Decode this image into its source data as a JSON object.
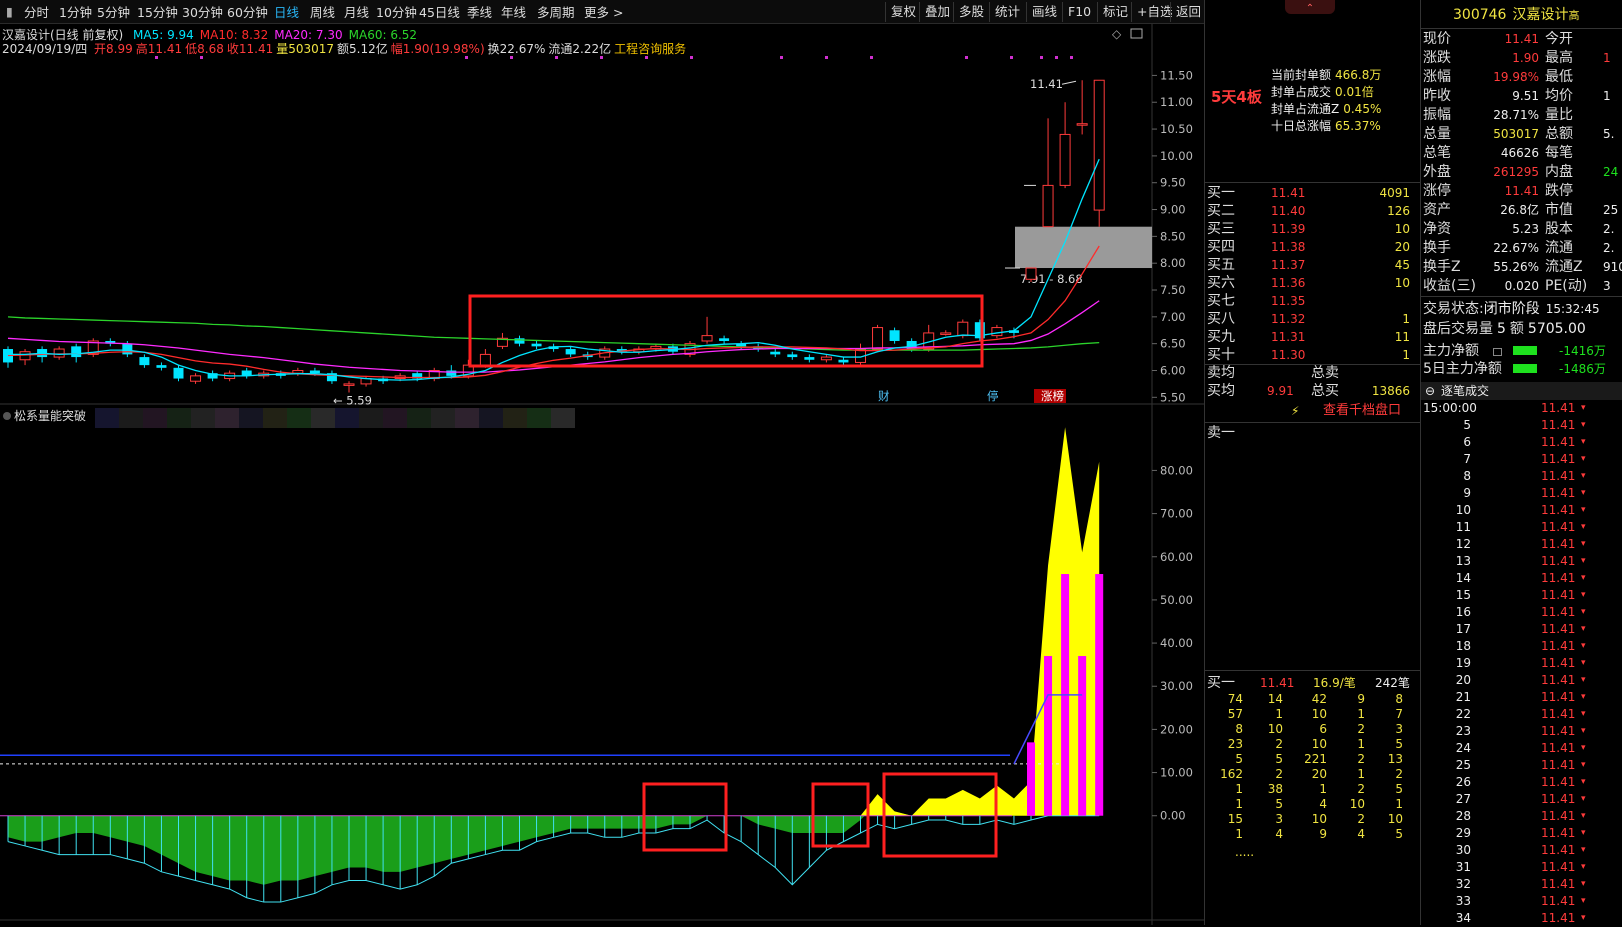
{
  "toolbar": {
    "periods": [
      "分时",
      "1分钟",
      "5分钟",
      "15分钟",
      "30分钟",
      "60分钟",
      "日线",
      "周线",
      "月线",
      "10分钟",
      "45日线",
      "季线",
      "年线",
      "多周期",
      "更多 >"
    ],
    "active": "日线",
    "right": [
      "复权",
      "叠加",
      "多股",
      "统计",
      "画线",
      "F10",
      "标记",
      "+自选",
      "返回"
    ]
  },
  "chart": {
    "title": "汉嘉设计(日线 前复权)",
    "ma": [
      {
        "label": "MA5: 9.94",
        "color": "#00e5ff"
      },
      {
        "label": "MA10: 8.32",
        "color": "#ff2b2b"
      },
      {
        "label": "MA20: 7.30",
        "color": "#ff2bff"
      },
      {
        "label": "MA60: 6.52",
        "color": "#2bd42b"
      }
    ],
    "date": "2024/09/19/四",
    "ohlc": [
      {
        "t": "开8.99",
        "c": "#ff3b3b"
      },
      {
        "t": "高11.41",
        "c": "#ff3b3b"
      },
      {
        "t": "低8.68",
        "c": "#ff3b3b"
      },
      {
        "t": "收11.41",
        "c": "#ff3b3b"
      },
      {
        "t": "量503017",
        "c": "#f0e442"
      },
      {
        "t": "额5.12亿",
        "c": "#ddd"
      },
      {
        "t": "幅1.90(19.98%)",
        "c": "#ff3b3b"
      },
      {
        "t": "换22.67%",
        "c": "#ddd"
      },
      {
        "t": "流通2.22亿",
        "c": "#ddd"
      },
      {
        "t": "工程咨询服务",
        "c": "#f0c000"
      }
    ],
    "y_ticks": [
      "11.50",
      "11.00",
      "10.50",
      "10.00",
      "9.50",
      "9.00",
      "8.50",
      "8.00",
      "7.50",
      "7.00",
      "6.50",
      "6.00",
      "5.50"
    ],
    "y_range": [
      5.45,
      11.75
    ],
    "high_label": "11.41",
    "low_label": "5.59",
    "gap_label": "7.91 - 8.68",
    "markers": [
      "财",
      "停",
      "涨榜"
    ],
    "candles": [
      [
        6.4,
        6.15,
        6.45,
        6.05
      ],
      [
        6.2,
        6.35,
        6.4,
        6.1
      ],
      [
        6.4,
        6.25,
        6.45,
        6.15
      ],
      [
        6.25,
        6.4,
        6.45,
        6.2
      ],
      [
        6.45,
        6.25,
        6.5,
        6.15
      ],
      [
        6.3,
        6.55,
        6.6,
        6.25
      ],
      [
        6.55,
        6.5,
        6.6,
        6.45
      ],
      [
        6.5,
        6.3,
        6.55,
        6.25
      ],
      [
        6.25,
        6.1,
        6.3,
        6.05
      ],
      [
        6.1,
        6.05,
        6.15,
        6.0
      ],
      [
        6.05,
        5.85,
        6.1,
        5.8
      ],
      [
        5.8,
        5.9,
        5.95,
        5.75
      ],
      [
        5.95,
        5.85,
        6.0,
        5.8
      ],
      [
        5.85,
        5.95,
        6.0,
        5.8
      ],
      [
        6.0,
        5.9,
        6.05,
        5.85
      ],
      [
        5.9,
        5.95,
        6.0,
        5.85
      ],
      [
        5.95,
        5.9,
        6.0,
        5.85
      ],
      [
        5.95,
        6.0,
        6.05,
        5.9
      ],
      [
        6.0,
        5.95,
        6.05,
        5.9
      ],
      [
        5.95,
        5.8,
        6.0,
        5.75
      ],
      [
        5.75,
        5.75,
        5.8,
        5.59
      ],
      [
        5.75,
        5.85,
        5.9,
        5.7
      ],
      [
        5.85,
        5.8,
        5.9,
        5.75
      ],
      [
        5.85,
        5.9,
        5.95,
        5.8
      ],
      [
        5.95,
        5.85,
        6.0,
        5.8
      ],
      [
        5.85,
        6.0,
        6.05,
        5.8
      ],
      [
        6.0,
        5.9,
        6.1,
        5.85
      ],
      [
        5.9,
        6.1,
        6.2,
        5.85
      ],
      [
        6.1,
        6.3,
        6.4,
        6.05
      ],
      [
        6.45,
        6.6,
        6.7,
        6.4
      ],
      [
        6.6,
        6.5,
        6.65,
        6.45
      ],
      [
        6.5,
        6.45,
        6.55,
        6.4
      ],
      [
        6.45,
        6.4,
        6.5,
        6.35
      ],
      [
        6.4,
        6.3,
        6.45,
        6.25
      ],
      [
        6.3,
        6.25,
        6.35,
        6.2
      ],
      [
        6.25,
        6.4,
        6.45,
        6.2
      ],
      [
        6.4,
        6.35,
        6.45,
        6.3
      ],
      [
        6.35,
        6.4,
        6.45,
        6.3
      ],
      [
        6.4,
        6.45,
        6.5,
        6.35
      ],
      [
        6.45,
        6.35,
        6.5,
        6.3
      ],
      [
        6.3,
        6.5,
        6.55,
        6.25
      ],
      [
        6.55,
        6.65,
        7.0,
        6.5
      ],
      [
        6.6,
        6.55,
        6.65,
        6.5
      ],
      [
        6.5,
        6.45,
        6.55,
        6.4
      ],
      [
        6.45,
        6.4,
        6.5,
        6.35
      ],
      [
        6.35,
        6.3,
        6.4,
        6.25
      ],
      [
        6.3,
        6.25,
        6.35,
        6.2
      ],
      [
        6.25,
        6.2,
        6.3,
        6.15
      ],
      [
        6.2,
        6.25,
        6.3,
        6.15
      ],
      [
        6.2,
        6.15,
        6.25,
        6.1
      ],
      [
        6.15,
        6.4,
        6.5,
        6.1
      ],
      [
        6.4,
        6.8,
        6.85,
        6.35
      ],
      [
        6.75,
        6.55,
        6.8,
        6.5
      ],
      [
        6.55,
        6.4,
        6.6,
        6.35
      ],
      [
        6.4,
        6.7,
        6.85,
        6.35
      ],
      [
        6.7,
        6.7,
        6.75,
        6.65
      ],
      [
        6.65,
        6.9,
        6.95,
        6.6
      ],
      [
        6.9,
        6.6,
        6.95,
        6.55
      ],
      [
        6.65,
        6.8,
        6.85,
        6.6
      ],
      [
        6.75,
        6.7,
        6.8,
        6.6
      ],
      [
        7.7,
        7.91,
        7.91,
        7.65
      ],
      [
        8.68,
        9.45,
        10.7,
        8.68
      ],
      [
        9.45,
        10.4,
        11.0,
        9.4
      ],
      [
        10.6,
        10.6,
        11.41,
        10.4
      ],
      [
        8.99,
        11.41,
        11.41,
        8.68
      ]
    ],
    "ma_series": {
      "ma5": [
        6.3,
        6.3,
        6.32,
        6.3,
        6.31,
        6.34,
        6.38,
        6.38,
        6.34,
        6.25,
        6.1,
        6.0,
        5.93,
        5.9,
        5.9,
        5.92,
        5.93,
        5.94,
        5.94,
        5.92,
        5.88,
        5.85,
        5.83,
        5.82,
        5.83,
        5.86,
        5.88,
        5.93,
        6.0,
        6.15,
        6.28,
        6.38,
        6.44,
        6.45,
        6.4,
        6.37,
        6.34,
        6.34,
        6.37,
        6.39,
        6.42,
        6.47,
        6.49,
        6.5,
        6.52,
        6.47,
        6.4,
        6.35,
        6.3,
        6.25,
        6.25,
        6.35,
        6.42,
        6.45,
        6.53,
        6.62,
        6.66,
        6.65,
        6.7,
        6.74,
        7.0,
        7.7,
        8.4,
        9.2,
        9.94
      ],
      "ma10": [
        6.28,
        6.29,
        6.3,
        6.31,
        6.31,
        6.32,
        6.34,
        6.35,
        6.34,
        6.3,
        6.24,
        6.18,
        6.14,
        6.12,
        6.08,
        6.02,
        5.97,
        5.94,
        5.92,
        5.91,
        5.9,
        5.89,
        5.88,
        5.87,
        5.87,
        5.87,
        5.87,
        5.88,
        5.91,
        5.98,
        6.06,
        6.13,
        6.19,
        6.23,
        6.28,
        6.33,
        6.36,
        6.39,
        6.41,
        6.4,
        6.39,
        6.41,
        6.42,
        6.43,
        6.44,
        6.44,
        6.44,
        6.43,
        6.42,
        6.4,
        6.37,
        6.37,
        6.38,
        6.4,
        6.42,
        6.44,
        6.5,
        6.55,
        6.58,
        6.63,
        6.7,
        6.95,
        7.3,
        7.8,
        8.32
      ],
      "ma20": [
        6.6,
        6.58,
        6.56,
        6.54,
        6.53,
        6.52,
        6.51,
        6.5,
        6.48,
        6.45,
        6.42,
        6.38,
        6.34,
        6.3,
        6.27,
        6.24,
        6.2,
        6.16,
        6.12,
        6.09,
        6.06,
        6.04,
        6.02,
        6.0,
        5.99,
        5.98,
        5.97,
        5.97,
        5.97,
        5.99,
        6.01,
        6.04,
        6.07,
        6.1,
        6.13,
        6.16,
        6.2,
        6.24,
        6.27,
        6.3,
        6.32,
        6.35,
        6.37,
        6.39,
        6.4,
        6.41,
        6.41,
        6.41,
        6.41,
        6.41,
        6.41,
        6.42,
        6.42,
        6.43,
        6.44,
        6.45,
        6.46,
        6.48,
        6.49,
        6.5,
        6.56,
        6.68,
        6.87,
        7.08,
        7.3
      ],
      "ma60": [
        7.0,
        6.98,
        6.97,
        6.96,
        6.95,
        6.94,
        6.93,
        6.92,
        6.91,
        6.9,
        6.89,
        6.88,
        6.86,
        6.85,
        6.83,
        6.82,
        6.8,
        6.78,
        6.76,
        6.74,
        6.72,
        6.7,
        6.68,
        6.66,
        6.64,
        6.62,
        6.61,
        6.6,
        6.59,
        6.58,
        6.57,
        6.56,
        6.55,
        6.54,
        6.53,
        6.52,
        6.51,
        6.5,
        6.49,
        6.48,
        6.47,
        6.46,
        6.45,
        6.44,
        6.43,
        6.42,
        6.41,
        6.4,
        6.39,
        6.38,
        6.38,
        6.38,
        6.38,
        6.38,
        6.38,
        6.38,
        6.38,
        6.39,
        6.4,
        6.41,
        6.42,
        6.44,
        6.47,
        6.5,
        6.52
      ]
    }
  },
  "indicator": {
    "title": "松系量能突破",
    "y_ticks": [
      "80.00",
      "70.00",
      "60.00",
      "50.00",
      "40.00",
      "30.00",
      "20.00",
      "10.00",
      "0.00"
    ],
    "y_range": [
      -23,
      94
    ],
    "green": [
      -5,
      -6,
      -6,
      -5,
      -4,
      -4,
      -5,
      -6,
      -7,
      -9,
      -11,
      -13,
      -14,
      -15,
      -15,
      -16,
      -15,
      -15,
      -14,
      -13,
      -12,
      -12,
      -13,
      -13,
      -12,
      -11,
      -10,
      -9,
      -8,
      -7,
      -6,
      -5,
      -4,
      -3,
      -3,
      -3,
      -3,
      -3,
      -3,
      -2,
      -2,
      0,
      0,
      0,
      -2,
      -3,
      -4,
      -4,
      -4,
      -4,
      -1,
      3,
      1,
      0,
      0,
      0,
      0,
      0,
      0,
      0,
      0,
      0,
      0,
      0,
      0
    ],
    "yellow": [
      0,
      0,
      0,
      0,
      0,
      0,
      0,
      0,
      0,
      0,
      0,
      0,
      0,
      0,
      0,
      0,
      0,
      0,
      0,
      0,
      0,
      0,
      0,
      0,
      0,
      0,
      0,
      0,
      0,
      0,
      0,
      0,
      0,
      0,
      0,
      0,
      0,
      0,
      0,
      0,
      0,
      0,
      0,
      0,
      0,
      0,
      0,
      0,
      0,
      0,
      0,
      5,
      1,
      0,
      4,
      4,
      6,
      4,
      7,
      4,
      8,
      58,
      90,
      61,
      82
    ],
    "cyan": [
      -6,
      -7,
      -8,
      -9,
      -9,
      -9,
      -9,
      -10,
      -11,
      -13,
      -14,
      -15,
      -16,
      -17,
      -19,
      -20,
      -20,
      -19,
      -18,
      -16,
      -15,
      -15,
      -16,
      -17,
      -16,
      -14,
      -11,
      -10,
      -9,
      -8,
      -8,
      -6,
      -5,
      -4,
      -4,
      -5,
      -5,
      -4,
      -4,
      -3,
      -3,
      -1,
      -4,
      -6,
      -9,
      -12,
      -16,
      -12,
      -8,
      -6,
      -4,
      -2,
      -3,
      -2,
      -1,
      -1,
      -2,
      -2,
      -1,
      -2,
      -1,
      0,
      0,
      0,
      0
    ],
    "magenta": [
      0,
      0,
      0,
      0,
      0,
      0,
      0,
      0,
      0,
      0,
      0,
      0,
      0,
      0,
      0,
      0,
      0,
      0,
      0,
      0,
      0,
      0,
      0,
      0,
      0,
      0,
      0,
      0,
      0,
      0,
      0,
      0,
      0,
      0,
      0,
      0,
      0,
      0,
      0,
      0,
      0,
      0,
      0,
      0,
      0,
      0,
      0,
      0,
      0,
      0,
      0,
      0,
      0,
      0,
      0,
      0,
      0,
      0,
      0,
      0,
      17,
      37,
      56,
      37,
      56
    ],
    "blue_level": 14,
    "dashed_level": 12
  },
  "seal": {
    "board": "5天4板",
    "items": [
      {
        "k": "当前封单额",
        "v": "466.8万"
      },
      {
        "k": "封单占成交",
        "v": "0.01倍"
      },
      {
        "k": "封单占流通Z",
        "v": "0.45%"
      },
      {
        "k": "十日总涨幅",
        "v": "65.37%"
      }
    ]
  },
  "orderbook": {
    "bids": [
      [
        "买一",
        "11.41",
        "4091"
      ],
      [
        "买二",
        "11.40",
        "126"
      ],
      [
        "买三",
        "11.39",
        "10"
      ],
      [
        "买四",
        "11.38",
        "20"
      ],
      [
        "买五",
        "11.37",
        "45"
      ],
      [
        "买六",
        "11.36",
        "10"
      ],
      [
        "买七",
        "11.35",
        ""
      ],
      [
        "买八",
        "11.32",
        "1"
      ],
      [
        "买九",
        "11.31",
        "11"
      ],
      [
        "买十",
        "11.30",
        "1"
      ]
    ],
    "sell_avg": "卖均",
    "total_sell": "总卖",
    "buy_avg": "买均",
    "buy_avg_val": "9.91",
    "total_buy": "总买",
    "total_buy_val": "13866",
    "link": "查看千档盘口",
    "sell1": "卖一",
    "queue_label": "买一",
    "queue_price": "11.41",
    "queue_avg": "16.9/笔",
    "queue_count": "242笔",
    "queue": [
      [
        "74",
        "14",
        "42",
        "9",
        "8"
      ],
      [
        "57",
        "1",
        "10",
        "1",
        "7"
      ],
      [
        "8",
        "10",
        "6",
        "2",
        "3"
      ],
      [
        "23",
        "2",
        "10",
        "1",
        "5"
      ],
      [
        "5",
        "5",
        "221",
        "2",
        "13"
      ],
      [
        "162",
        "2",
        "20",
        "1",
        "2"
      ],
      [
        "1",
        "38",
        "1",
        "2",
        "5"
      ],
      [
        "1",
        "5",
        "4",
        "10",
        "1"
      ],
      [
        "15",
        "3",
        "10",
        "2",
        "10"
      ],
      [
        "1",
        "4",
        "9",
        "4",
        "5"
      ]
    ],
    "more": "....."
  },
  "quote": {
    "code": "300746",
    "name": "汉嘉设计",
    "tag": "高",
    "rows": [
      [
        "现价",
        "11.41",
        "red",
        "今开",
        ""
      ],
      [
        "涨跌",
        "1.90",
        "red",
        "最高",
        "1"
      ],
      [
        "涨幅",
        "19.98%",
        "red",
        "最低",
        ""
      ],
      [
        "昨收",
        "9.51",
        "wht",
        "均价",
        "1"
      ],
      [
        "振幅",
        "28.71%",
        "wht",
        "量比",
        ""
      ],
      [
        "总量",
        "503017",
        "yel",
        "总额",
        "5."
      ],
      [
        "总笔",
        "46626",
        "wht",
        "每笔",
        ""
      ],
      [
        "外盘",
        "261295",
        "red",
        "内盘",
        "24"
      ],
      [
        "涨停",
        "11.41",
        "red",
        "跌停",
        ""
      ],
      [
        "资产",
        "26.8亿",
        "wht",
        "市值",
        "25"
      ],
      [
        "净资",
        "5.23",
        "wht",
        "股本",
        "2."
      ],
      [
        "换手",
        "22.67%",
        "wht",
        "流通",
        "2."
      ],
      [
        "换手Z",
        "55.26%",
        "wht",
        "流通Z",
        "910"
      ],
      [
        "收益(三)",
        "0.020",
        "wht",
        "PE(动)",
        "3"
      ]
    ],
    "status_label": "交易状态:",
    "status": "闭市阶段",
    "status_time": "15:32:45",
    "after_label": "盘后交易量",
    "after_val": "5",
    "after_amt_label": "额",
    "after_amt": "5705.00",
    "main_net": "主力净额",
    "main_net_val": "-1416万",
    "main_net5": "5日主力净额",
    "main_net5_val": "-1486万",
    "ticks_title": "逐笔成交",
    "ticks": [
      [
        "15:00:00",
        "11.41"
      ],
      [
        "5",
        "11.41"
      ],
      [
        "6",
        "11.41"
      ],
      [
        "7",
        "11.41"
      ],
      [
        "8",
        "11.41"
      ],
      [
        "9",
        "11.41"
      ],
      [
        "10",
        "11.41"
      ],
      [
        "11",
        "11.41"
      ],
      [
        "12",
        "11.41"
      ],
      [
        "13",
        "11.41"
      ],
      [
        "14",
        "11.41"
      ],
      [
        "15",
        "11.41"
      ],
      [
        "16",
        "11.41"
      ],
      [
        "17",
        "11.41"
      ],
      [
        "18",
        "11.41"
      ],
      [
        "19",
        "11.41"
      ],
      [
        "20",
        "11.41"
      ],
      [
        "21",
        "11.41"
      ],
      [
        "22",
        "11.41"
      ],
      [
        "23",
        "11.41"
      ],
      [
        "24",
        "11.41"
      ],
      [
        "25",
        "11.41"
      ],
      [
        "26",
        "11.41"
      ],
      [
        "27",
        "11.41"
      ],
      [
        "28",
        "11.41"
      ],
      [
        "29",
        "11.41"
      ],
      [
        "30",
        "11.41"
      ],
      [
        "31",
        "11.41"
      ],
      [
        "32",
        "11.41"
      ],
      [
        "33",
        "11.41"
      ],
      [
        "34",
        "11.41"
      ]
    ]
  },
  "colors": {
    "up": "#ff3b3b",
    "down": "#00e5ff",
    "ma5": "#00e5ff",
    "ma10": "#ff2b2b",
    "ma20": "#ff2bff",
    "ma60": "#2bd42b",
    "green": "#1a9e1a",
    "yellow": "#ffff00",
    "magenta": "#ff00ff",
    "box": "#ff2020"
  }
}
